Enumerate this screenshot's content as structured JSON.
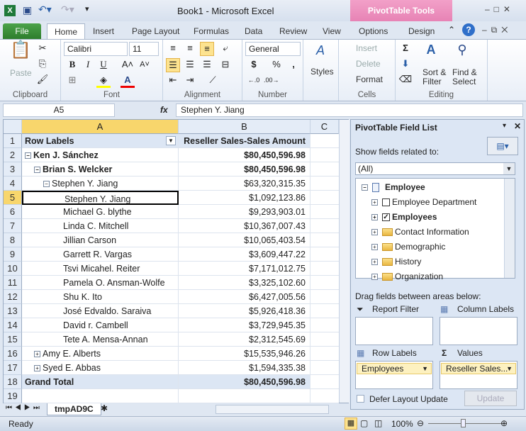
{
  "window": {
    "title": "Book1  -  Microsoft Excel",
    "context_tab": "PivotTable Tools"
  },
  "ribbon_tabs": [
    "File",
    "Home",
    "Insert",
    "Page Layout",
    "Formulas",
    "Data",
    "Review",
    "View",
    "Options",
    "Design"
  ],
  "ribbon": {
    "clipboard": {
      "label": "Clipboard",
      "paste": "Paste"
    },
    "font": {
      "label": "Font",
      "name": "Calibri",
      "size": "11",
      "bold": "B",
      "italic": "I",
      "underline": "U"
    },
    "alignment": {
      "label": "Alignment"
    },
    "number": {
      "label": "Number",
      "format": "General",
      "currency": "$",
      "percent": "%",
      "comma": ","
    },
    "styles": {
      "label": "Styles"
    },
    "cells": {
      "label": "Cells",
      "insert": "Insert",
      "delete": "Delete",
      "format": "Format"
    },
    "editing": {
      "label": "Editing",
      "sort": "Sort &",
      "filter": "Filter",
      "find": "Find &",
      "select": "Select"
    }
  },
  "formula_bar": {
    "name_box": "A5",
    "fx": "fx",
    "value": "Stephen Y. Jiang"
  },
  "grid": {
    "columns": [
      "A",
      "B",
      "C"
    ],
    "header": {
      "a": "Row Labels",
      "b": "Reseller Sales-Sales Amount"
    },
    "rows": [
      {
        "n": "1"
      },
      {
        "n": "2",
        "label": "Ken J. Sánchez",
        "value": "$80,450,596.98",
        "bold": true,
        "lvl": 0,
        "tog": "−"
      },
      {
        "n": "3",
        "label": "Brian S. Welcker",
        "value": "$80,450,596.98",
        "bold": true,
        "lvl": 1,
        "tog": "−"
      },
      {
        "n": "4",
        "label": "Stephen Y. Jiang",
        "value": "$63,320,315.35",
        "lvl": 2,
        "tog": "−"
      },
      {
        "n": "5",
        "label": "Stephen Y. Jiang",
        "value": "$1,092,123.86",
        "lvl": 3
      },
      {
        "n": "6",
        "label": "Michael G. blythe",
        "value": "$9,293,903.01",
        "lvl": 3
      },
      {
        "n": "7",
        "label": "Linda C. Mitchell",
        "value": "$10,367,007.43",
        "lvl": 3
      },
      {
        "n": "8",
        "label": "Jillian Carson",
        "value": "$10,065,403.54",
        "lvl": 3
      },
      {
        "n": "9",
        "label": "Garrett R. Vargas",
        "value": "$3,609,447.22",
        "lvl": 3
      },
      {
        "n": "10",
        "label": "Tsvi Micahel. Reiter",
        "value": "$7,171,012.75",
        "lvl": 3
      },
      {
        "n": "11",
        "label": "Pamela O. Ansman-Wolfe",
        "value": "$3,325,102.60",
        "lvl": 3
      },
      {
        "n": "12",
        "label": "Shu K. Ito",
        "value": "$6,427,005.56",
        "lvl": 3
      },
      {
        "n": "13",
        "label": "José Edvaldo. Saraiva",
        "value": "$5,926,418.36",
        "lvl": 3
      },
      {
        "n": "14",
        "label": "David r. Cambell",
        "value": "$3,729,945.35",
        "lvl": 3
      },
      {
        "n": "15",
        "label": "Tete A. Mensa-Annan",
        "value": "$2,312,545.69",
        "lvl": 3
      },
      {
        "n": "16",
        "label": "Amy E. Alberts",
        "value": "$15,535,946.26",
        "lvl": 1,
        "tog": "+"
      },
      {
        "n": "17",
        "label": "Syed E. Abbas",
        "value": "$1,594,335.38",
        "lvl": 1,
        "tog": "+"
      },
      {
        "n": "18",
        "label": "Grand Total",
        "value": "$80,450,596.98",
        "bold": true,
        "lvl": 0,
        "total": true
      },
      {
        "n": "19"
      }
    ],
    "sheet_tab": "tmpAD9C"
  },
  "field_list": {
    "title": "PivotTable Field List",
    "show_related": "Show fields related to:",
    "related_value": "(All)",
    "tree": [
      {
        "label": "Employee",
        "type": "table",
        "bold": true
      },
      {
        "label": "Employee Department",
        "type": "check",
        "checked": false
      },
      {
        "label": "Employees",
        "type": "check",
        "checked": true,
        "bold": true
      },
      {
        "label": "Contact Information",
        "type": "folder"
      },
      {
        "label": "Demographic",
        "type": "folder"
      },
      {
        "label": "History",
        "type": "folder"
      },
      {
        "label": "Organization",
        "type": "folder"
      }
    ],
    "drag_label": "Drag fields between areas below:",
    "report_filter": "Report Filter",
    "column_labels": "Column Labels",
    "row_labels": "Row Labels",
    "values": "Values",
    "row_chip": "Employees",
    "value_chip": "Reseller Sales...",
    "defer": "Defer Layout Update",
    "update": "Update"
  },
  "status": {
    "ready": "Ready",
    "zoom": "100%"
  }
}
